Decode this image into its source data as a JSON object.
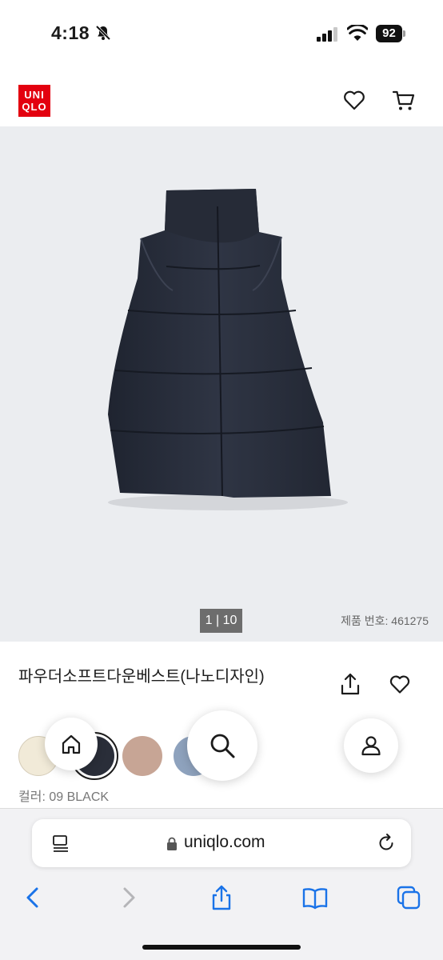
{
  "status_bar": {
    "time": "4:18",
    "battery": "92",
    "icons": [
      "bell-slash-icon",
      "signal-icon",
      "wifi-icon",
      "battery-icon"
    ]
  },
  "header": {
    "logo_line1": "UNI",
    "logo_line2": "QLO",
    "brand_color": "#e3000f",
    "icons": [
      "heart-icon",
      "cart-icon"
    ]
  },
  "gallery": {
    "counter": "1 | 10",
    "product_number": "제품 번호: 461275"
  },
  "product": {
    "name": "파우더소프트다운베스트(나노디자인)",
    "selected_color_label": "컬러: 09 BLACK",
    "swatches": [
      {
        "name": "cream",
        "color": "#f1ead8"
      },
      {
        "name": "black",
        "color": "#2a2e39",
        "selected": true
      },
      {
        "name": "beige",
        "color": "#c7a595"
      },
      {
        "name": "blue",
        "color": "#8ea2bd"
      }
    ]
  },
  "floating_nav": {
    "icons": [
      "home-icon",
      "search-icon",
      "user-icon"
    ]
  },
  "browser": {
    "url": "uniqlo.com",
    "icons": [
      "reader-icon",
      "lock-icon",
      "reload-icon",
      "back-icon",
      "forward-icon",
      "share-icon",
      "bookmarks-icon",
      "tabs-icon"
    ]
  }
}
